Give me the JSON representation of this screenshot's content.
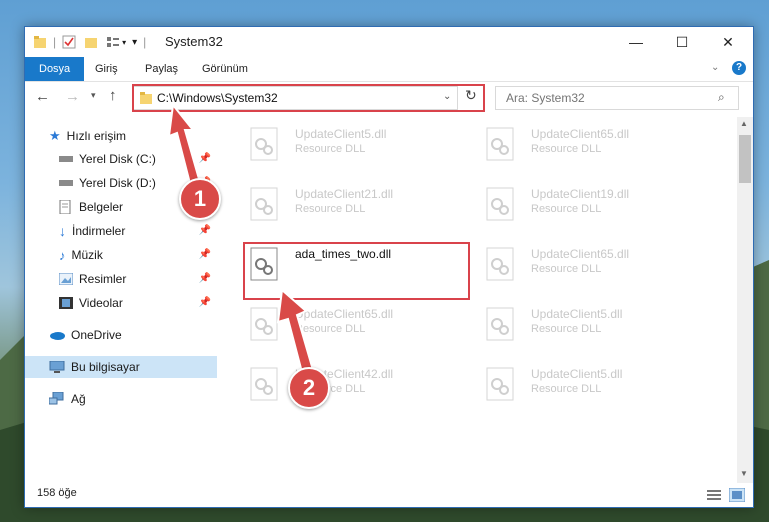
{
  "window": {
    "title": "System32",
    "minimize_glyph": "—",
    "maximize_glyph": "☐",
    "close_glyph": "✕"
  },
  "ribbon": {
    "tabs": [
      "Dosya",
      "Giriş",
      "Paylaş",
      "Görünüm"
    ],
    "active_tab_color": "#1979ca"
  },
  "address": {
    "path": "C:\\Windows\\System32",
    "search_placeholder": "Ara: System32"
  },
  "sidebar": {
    "items": [
      {
        "label": "Hızlı erişim",
        "icon": "star-icon"
      },
      {
        "label": "Yerel Disk (C:)",
        "icon": "drive-icon",
        "pinned": true
      },
      {
        "label": "Yerel Disk (D:)",
        "icon": "drive-icon",
        "pinned": true
      },
      {
        "label": "Belgeler",
        "icon": "documents-icon",
        "pinned": true
      },
      {
        "label": "İndirmeler",
        "icon": "download-icon",
        "pinned": true
      },
      {
        "label": "Müzik",
        "icon": "music-icon",
        "pinned": true
      },
      {
        "label": "Resimler",
        "icon": "pictures-icon",
        "pinned": true
      },
      {
        "label": "Videolar",
        "icon": "videos-icon",
        "pinned": true
      },
      {
        "label": "OneDrive",
        "icon": "onedrive-icon"
      },
      {
        "label": "Bu bilgisayar",
        "icon": "computer-icon"
      },
      {
        "label": "Ağ",
        "icon": "network-icon"
      }
    ]
  },
  "files": [
    {
      "name": "UpdateClient5.dll",
      "desc": "Resource DLL"
    },
    {
      "name": "UpdateClient65.dll",
      "desc": "Resource DLL"
    },
    {
      "name": "UpdateClient21.dll",
      "desc": "Resource DLL"
    },
    {
      "name": "UpdateClient19.dll",
      "desc": "Resource DLL"
    },
    {
      "name": "ada_times_two.dll",
      "desc": ""
    },
    {
      "name": "UpdateClient65.dll",
      "desc": "Resource DLL"
    },
    {
      "name": "UpdateClient65.dll",
      "desc": "Resource DLL"
    },
    {
      "name": "UpdateClient5.dll",
      "desc": "Resource DLL"
    },
    {
      "name": "UpdateClient42.dll",
      "desc": "Resource DLL"
    },
    {
      "name": "UpdateClient5.dll",
      "desc": "Resource DLL"
    }
  ],
  "status": {
    "count": "158 öğe"
  },
  "annotations": {
    "step1": "1",
    "step2": "2",
    "color": "#d94a48"
  }
}
